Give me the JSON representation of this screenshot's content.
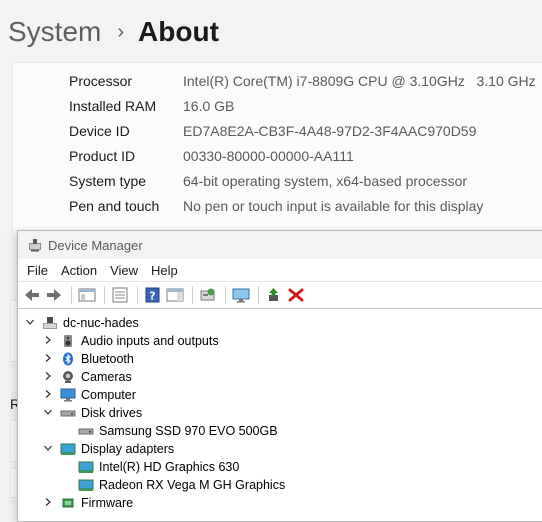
{
  "settings": {
    "breadcrumb": {
      "parent": "System",
      "separator": "›",
      "current": "About"
    },
    "specs": [
      {
        "label": "Processor",
        "value": "Intel(R) Core(TM) i7-8809G CPU @ 3.10GHz   3.10 GHz"
      },
      {
        "label": "Installed RAM",
        "value": "16.0 GB"
      },
      {
        "label": "Device ID",
        "value": "ED7A8E2A-CB3F-4A48-97D2-3F4AAC970D59"
      },
      {
        "label": "Product ID",
        "value": "00330-80000-00000-AA111"
      },
      {
        "label": "System type",
        "value": "64-bit operating system, x64-based processor"
      },
      {
        "label": "Pen and touch",
        "value": "No pen or touch input is available for this display"
      }
    ],
    "partial_letter": "R"
  },
  "device_manager": {
    "title": "Device Manager",
    "menu": [
      "File",
      "Action",
      "View",
      "Help"
    ],
    "toolbar_icons": [
      "back-arrow-icon",
      "forward-arrow-icon",
      "show-hide-console-tree-icon",
      "properties-list-icon",
      "help-icon",
      "action-pane-icon",
      "scan-hardware-icon",
      "monitor-icon",
      "update-driver-icon",
      "uninstall-x-icon"
    ],
    "tree": [
      {
        "label": "dc-nuc-hades",
        "expander": "v",
        "icon": "computer-root-icon"
      },
      {
        "label": "Audio inputs and outputs",
        "expander": ">",
        "icon": "speaker-icon"
      },
      {
        "label": "Bluetooth",
        "expander": ">",
        "icon": "bluetooth-icon"
      },
      {
        "label": "Cameras",
        "expander": ">",
        "icon": "camera-icon"
      },
      {
        "label": "Computer",
        "expander": ">",
        "icon": "computer-icon"
      },
      {
        "label": "Disk drives",
        "expander": "v",
        "icon": "disk-drive-icon"
      },
      {
        "label": "Samsung SSD 970 EVO 500GB",
        "expander": "",
        "icon": "disk-drive-icon"
      },
      {
        "label": "Display adapters",
        "expander": "v",
        "icon": "display-adapter-icon"
      },
      {
        "label": "Intel(R) HD Graphics 630",
        "expander": "",
        "icon": "display-adapter-icon"
      },
      {
        "label": "Radeon RX Vega M GH Graphics",
        "expander": "",
        "icon": "display-adapter-icon"
      },
      {
        "label": "Firmware",
        "expander": ">",
        "icon": "firmware-icon"
      }
    ]
  },
  "colors": {
    "accent": "#0067c0",
    "uninstall": "#d11a1a",
    "update": "#2e8b2e"
  }
}
